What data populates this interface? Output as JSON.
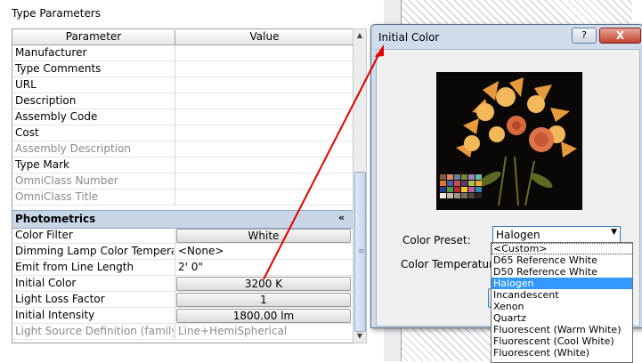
{
  "type_parameters": {
    "title": "Type Parameters",
    "columns": {
      "parameter": "Parameter",
      "value": "Value"
    },
    "rows_top": [
      {
        "name": "Manufacturer",
        "value": ""
      },
      {
        "name": "Type Comments",
        "value": ""
      },
      {
        "name": "URL",
        "value": ""
      },
      {
        "name": "Description",
        "value": ""
      },
      {
        "name": "Assembly Code",
        "value": ""
      },
      {
        "name": "Cost",
        "value": ""
      },
      {
        "name": "Assembly Description",
        "value": ""
      },
      {
        "name": "Type Mark",
        "value": ""
      },
      {
        "name": "OmniClass Number",
        "value": ""
      },
      {
        "name": "OmniClass Title",
        "value": ""
      }
    ],
    "group": "Photometrics",
    "group_icon": "collapse-chevrons-icon",
    "rows_photometrics": [
      {
        "name": "Color Filter",
        "value": "White"
      },
      {
        "name": "Dimming Lamp Color Temperatu",
        "value": "<None>"
      },
      {
        "name": "Emit from Line Length",
        "value": "2'  0\""
      },
      {
        "name": "Initial Color",
        "value": "3200 K"
      },
      {
        "name": "Light Loss Factor",
        "value": "1"
      },
      {
        "name": "Initial Intensity",
        "value": "1800.00 lm"
      },
      {
        "name": "Light Source Definition (family)",
        "value": "Line+HemiSpherical"
      }
    ]
  },
  "dialog": {
    "title": "Initial Color",
    "help_label": "?",
    "close_label": "X",
    "color_preset_label": "Color Preset:",
    "color_temperature_label": "Color Temperature:",
    "color_preset_value": "Halogen",
    "preset_options": [
      "<Custom>",
      "D65 Reference White",
      "D50 Reference White",
      "Halogen",
      "Incandescent",
      "Xenon",
      "Quartz",
      "Fluorescent (Warm White)",
      "Fluorescent (Cool White)",
      "Fluorescent (White)"
    ],
    "highlighted_option": "Halogen"
  },
  "colors": {
    "annotation_arrow": "#e00000",
    "group_header": "#c8d6e8",
    "dialog_frame": "#cfdcec",
    "list_highlight": "#3399ff"
  }
}
